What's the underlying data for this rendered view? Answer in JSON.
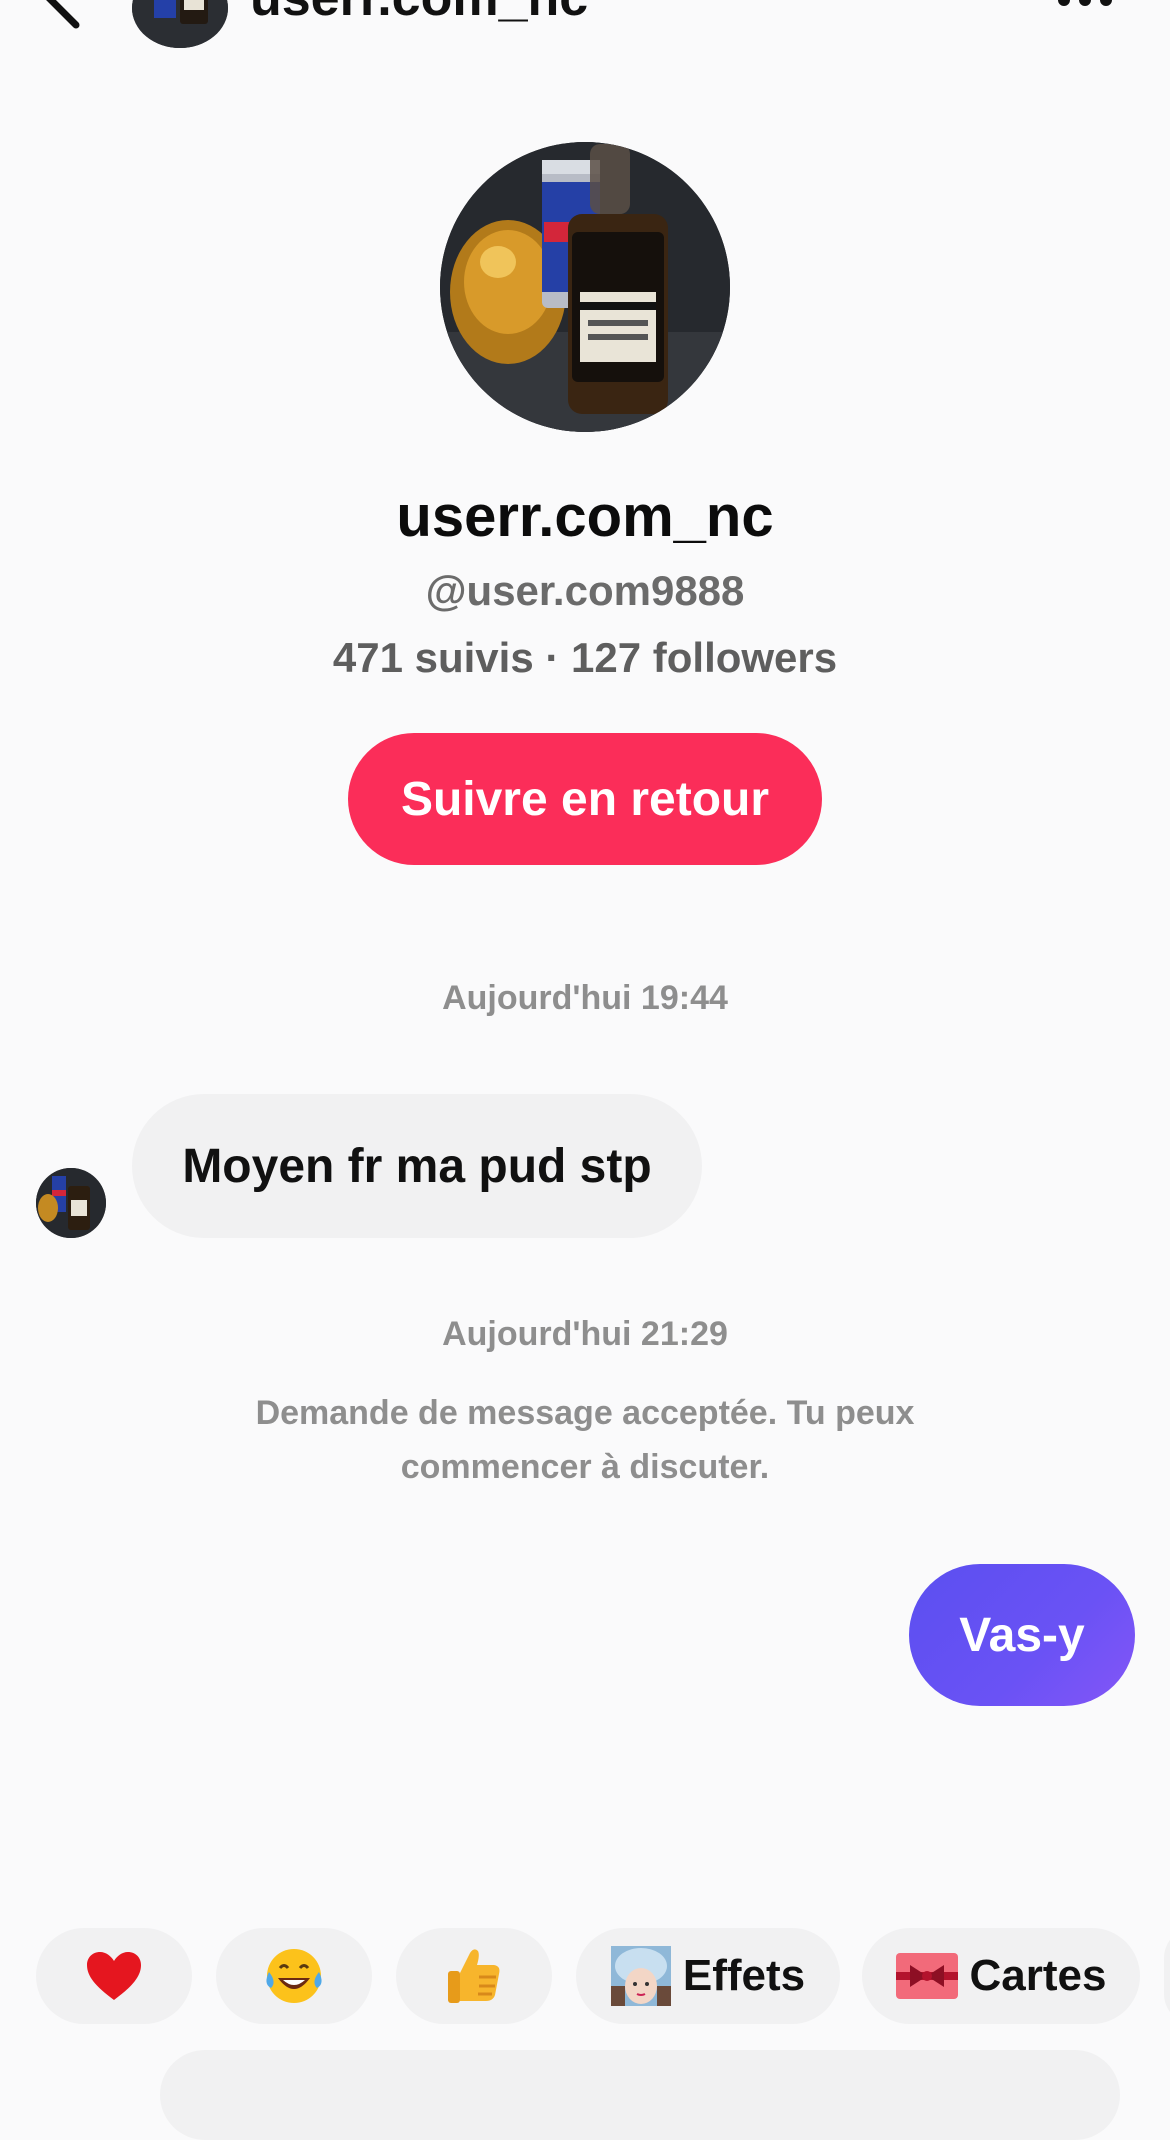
{
  "header": {
    "title": "userr.com_nc"
  },
  "profile": {
    "name": "userr.com_nc",
    "handle": "@user.com9888",
    "stats": "471 suivis · 127 followers",
    "follow_label": "Suivre en retour"
  },
  "chat": {
    "timestamp_1": "Aujourd'hui 19:44",
    "incoming_message": "Moyen fr ma pud stp",
    "timestamp_2": "Aujourd'hui 21:29",
    "system_note": "Demande de message acceptée. Tu peux commencer à discuter.",
    "outgoing_message": "Vas-y"
  },
  "quick_replies": {
    "effects_label": "Effets",
    "cards_label": "Cartes"
  },
  "icons": {
    "heart": "heart-icon",
    "laugh": "tears-of-joy-icon",
    "thumb": "thumbs-up-icon",
    "effects": "effects-thumbnail-icon",
    "cards": "card-ribbon-icon"
  },
  "colors": {
    "follow_button": "#fb2d59",
    "outgoing_bubble": "#6a52f5",
    "incoming_bubble": "#f1f1f2",
    "muted_text": "#8e8e8e"
  }
}
